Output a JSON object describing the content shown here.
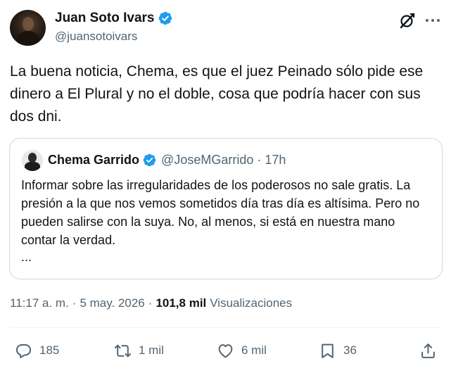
{
  "author": {
    "name": "Juan Soto Ivars",
    "handle": "@juansotoivars"
  },
  "post": {
    "text": "La buena noticia, Chema, es que el juez Peinado sólo pide ese dinero a El Plural y no el doble, cosa que podría hacer con sus dos dni."
  },
  "quoted": {
    "name": "Chema Garrido",
    "handle": "@JoseMGarrido",
    "dot": "·",
    "time": "17h",
    "text": "Informar sobre las irregularidades de los poderosos no sale gratis. La presión a la que nos vemos sometidos día tras día es altísima. Pero no pueden salirse con la suya. No, al menos, si está en nuestra mano contar la verdad.",
    "ellipsis": "..."
  },
  "meta": {
    "time": "11:17 a. m.",
    "sep1": "·",
    "date": "5 may. 2026",
    "sep2": "·",
    "views_count": "101,8 mil",
    "views_label": "Visualizaciones"
  },
  "actions": {
    "replies": "185",
    "reposts": "1 mil",
    "likes": "6 mil",
    "bookmarks": "36"
  },
  "icons": {
    "verified": "verified-badge-icon",
    "grok": "grok-icon",
    "more": "more-options-icon",
    "reply": "reply-icon",
    "repost": "repost-icon",
    "like": "heart-icon",
    "bookmark": "bookmark-icon",
    "share": "share-icon"
  },
  "colors": {
    "verified": "#1d9bf0",
    "text": "#0f1419",
    "secondary": "#536471",
    "border": "#cfd9de"
  }
}
